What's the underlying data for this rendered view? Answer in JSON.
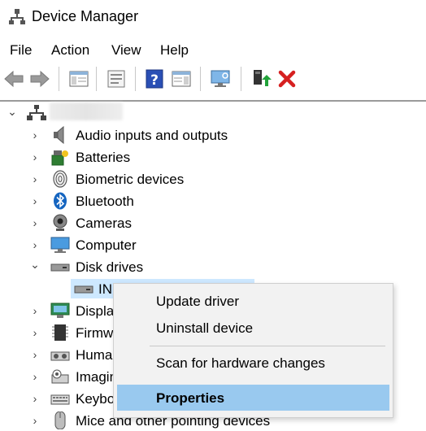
{
  "window": {
    "title": "Device Manager"
  },
  "menu": {
    "items": [
      "File",
      "Action",
      "View",
      "Help"
    ]
  },
  "toolbar": {
    "icons": [
      "back-icon",
      "forward-icon",
      "show-hide-console-tree-icon",
      "properties-icon",
      "help-icon",
      "action-pane-icon",
      "monitor-icon",
      "update-driver-icon",
      "uninstall-icon"
    ]
  },
  "tree": {
    "root_name": "",
    "categories": [
      {
        "label": "Audio inputs and outputs",
        "icon": "speaker-icon",
        "expanded": false
      },
      {
        "label": "Batteries",
        "icon": "battery-icon",
        "expanded": false
      },
      {
        "label": "Biometric devices",
        "icon": "fingerprint-icon",
        "expanded": false
      },
      {
        "label": "Bluetooth",
        "icon": "bluetooth-icon",
        "expanded": false
      },
      {
        "label": "Cameras",
        "icon": "camera-icon",
        "expanded": false
      },
      {
        "label": "Computer",
        "icon": "computer-icon",
        "expanded": false
      },
      {
        "label": "Disk drives",
        "icon": "disk-drive-icon",
        "expanded": true
      },
      {
        "label": "IN",
        "icon": "disk-drive-icon",
        "child": true,
        "selected": true
      },
      {
        "label": "Displa",
        "icon": "display-adapter-icon",
        "expanded": false
      },
      {
        "label": "Firmw",
        "icon": "firmware-icon",
        "expanded": false
      },
      {
        "label": "Huma",
        "icon": "hid-icon",
        "expanded": false
      },
      {
        "label": "Imagin",
        "icon": "imaging-icon",
        "expanded": false
      },
      {
        "label": "Keybo",
        "icon": "keyboard-icon",
        "expanded": false
      },
      {
        "label": "Mice and other pointing devices",
        "icon": "mouse-icon",
        "expanded": false
      }
    ]
  },
  "context_menu": {
    "update_driver": "Update driver",
    "uninstall_device": "Uninstall device",
    "scan": "Scan for hardware changes",
    "properties": "Properties"
  },
  "colors": {
    "selection": "#cde8ff",
    "context_highlight": "#99c9ef",
    "uninstall_red": "#d62020",
    "help_blue": "#2a4fb5"
  }
}
